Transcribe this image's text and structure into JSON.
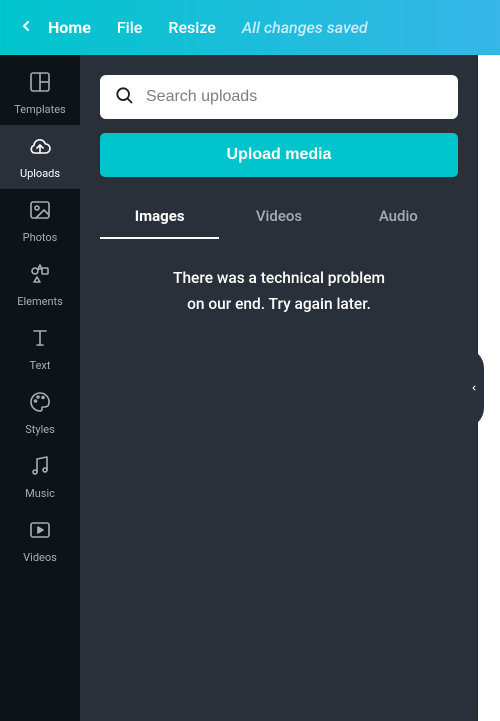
{
  "topbar": {
    "home": "Home",
    "file": "File",
    "resize": "Resize",
    "saved": "All changes saved"
  },
  "sidebar": {
    "items": [
      {
        "label": "Templates"
      },
      {
        "label": "Uploads"
      },
      {
        "label": "Photos"
      },
      {
        "label": "Elements"
      },
      {
        "label": "Text"
      },
      {
        "label": "Styles"
      },
      {
        "label": "Music"
      },
      {
        "label": "Videos"
      }
    ]
  },
  "panel": {
    "search_placeholder": "Search uploads",
    "upload_btn": "Upload media",
    "tabs": [
      {
        "label": "Images"
      },
      {
        "label": "Videos"
      },
      {
        "label": "Audio"
      }
    ],
    "error_line1": "There was a technical problem",
    "error_line2": "on our end. Try again later."
  }
}
